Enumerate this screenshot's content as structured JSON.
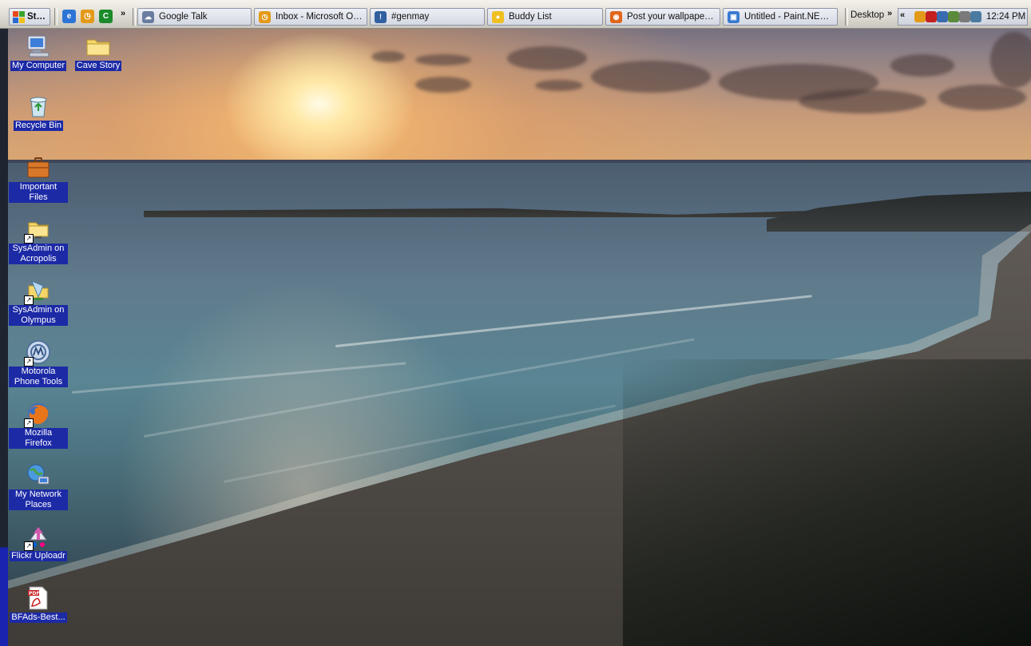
{
  "taskbar": {
    "start_label": "Start",
    "quick_launch": [
      {
        "icon": "ie-icon",
        "color": "#2c74d6"
      },
      {
        "icon": "outlook-clock-icon",
        "color": "#e39a18"
      },
      {
        "icon": "green-app-icon",
        "color": "#1a8a2a"
      }
    ],
    "quick_launch_more": "»",
    "windows": [
      {
        "label": "Google Talk",
        "icon": "google-talk-icon",
        "color": "#6a7da0"
      },
      {
        "label": "Inbox - Microsoft Outlo...",
        "icon": "outlook-icon",
        "color": "#e39a18"
      },
      {
        "label": "#genmay",
        "icon": "irc-icon",
        "color": "#3060a0"
      },
      {
        "label": "Buddy List",
        "icon": "aim-icon",
        "color": "#f0c020"
      },
      {
        "label": "Post your wallpaper, a...",
        "icon": "firefox-icon",
        "color": "#e0661a"
      },
      {
        "label": "Untitled - Paint.NET v...",
        "icon": "paintnet-icon",
        "color": "#3a7ad0"
      }
    ],
    "desktop_toolbar": "Desktop",
    "desktop_more": "»",
    "tray_expand": "«",
    "tray_icons": [
      {
        "icon": "outlook-tray-icon",
        "color": "#e39a18"
      },
      {
        "icon": "gmail-tray-icon",
        "color": "#c42020"
      },
      {
        "icon": "network-tray-icon",
        "color": "#3a6ab0"
      },
      {
        "icon": "messenger-tray-icon",
        "color": "#5a8a3a"
      },
      {
        "icon": "satellite-tray-icon",
        "color": "#7a7a7a"
      },
      {
        "icon": "power-tray-icon",
        "color": "#4a7aa0"
      }
    ],
    "clock": "12:24 PM"
  },
  "desktop_icons": [
    {
      "name": "my-computer",
      "label": "My Computer",
      "icon": "my-computer-icon"
    },
    {
      "name": "cave-story",
      "label": "Cave Story",
      "icon": "folder-icon"
    },
    {
      "name": "recycle-bin",
      "label": "Recycle Bin",
      "icon": "recycle-bin-icon"
    },
    {
      "name": "important-files",
      "label": "Important Files",
      "icon": "briefcase-icon"
    },
    {
      "name": "sysadmin-acropolis",
      "label": "SysAdmin on Acropolis",
      "icon": "network-folder-icon"
    },
    {
      "name": "sysadmin-olympus",
      "label": "SysAdmin on Olympus",
      "icon": "network-share-icon"
    },
    {
      "name": "motorola-phone-tools",
      "label": "Motorola Phone Tools",
      "icon": "motorola-icon"
    },
    {
      "name": "mozilla-firefox",
      "label": "Mozilla Firefox",
      "icon": "firefox-icon"
    },
    {
      "name": "my-network-places",
      "label": "My Network Places",
      "icon": "network-places-icon"
    },
    {
      "name": "flickr-uploadr",
      "label": "Flickr Uploadr",
      "icon": "flickr-uploadr-icon"
    },
    {
      "name": "bfads-pdf",
      "label": "BFAds-Best...",
      "icon": "pdf-icon"
    }
  ]
}
